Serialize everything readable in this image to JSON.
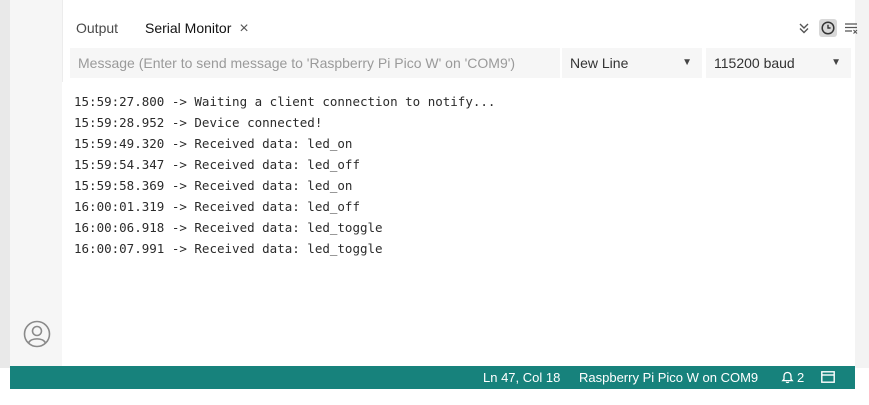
{
  "tabs": {
    "output_label": "Output",
    "serial_label": "Serial Monitor",
    "close_glyph": "×"
  },
  "controls": {
    "message_placeholder": "Message (Enter to send message to 'Raspberry Pi Pico W' on 'COM9')",
    "line_ending": "New Line",
    "baud_rate": "115200 baud"
  },
  "console_lines": [
    "15:59:27.800 -> Waiting a client connection to notify...",
    "15:59:28.952 -> Device connected!",
    "15:59:49.320 -> Received data: led_on",
    "15:59:54.347 -> Received data: led_off",
    "15:59:58.369 -> Received data: led_on",
    "16:00:01.319 -> Received data: led_off",
    "16:00:06.918 -> Received data: led_toggle",
    "16:00:07.991 -> Received data: led_toggle"
  ],
  "status": {
    "cursor_position": "Ln 47, Col 18",
    "board": "Raspberry Pi Pico W on COM9",
    "notification_count": "2"
  },
  "icons": {
    "collapse": "chevron-double-down-icon",
    "clock": "clock-icon",
    "clear": "clear-output-icon",
    "account": "account-icon",
    "notification": "bell-icon",
    "panel": "panel-icon"
  },
  "colors": {
    "statusbar": "#17827c",
    "background": "#ffffff",
    "input_background": "#f6f6f6"
  }
}
